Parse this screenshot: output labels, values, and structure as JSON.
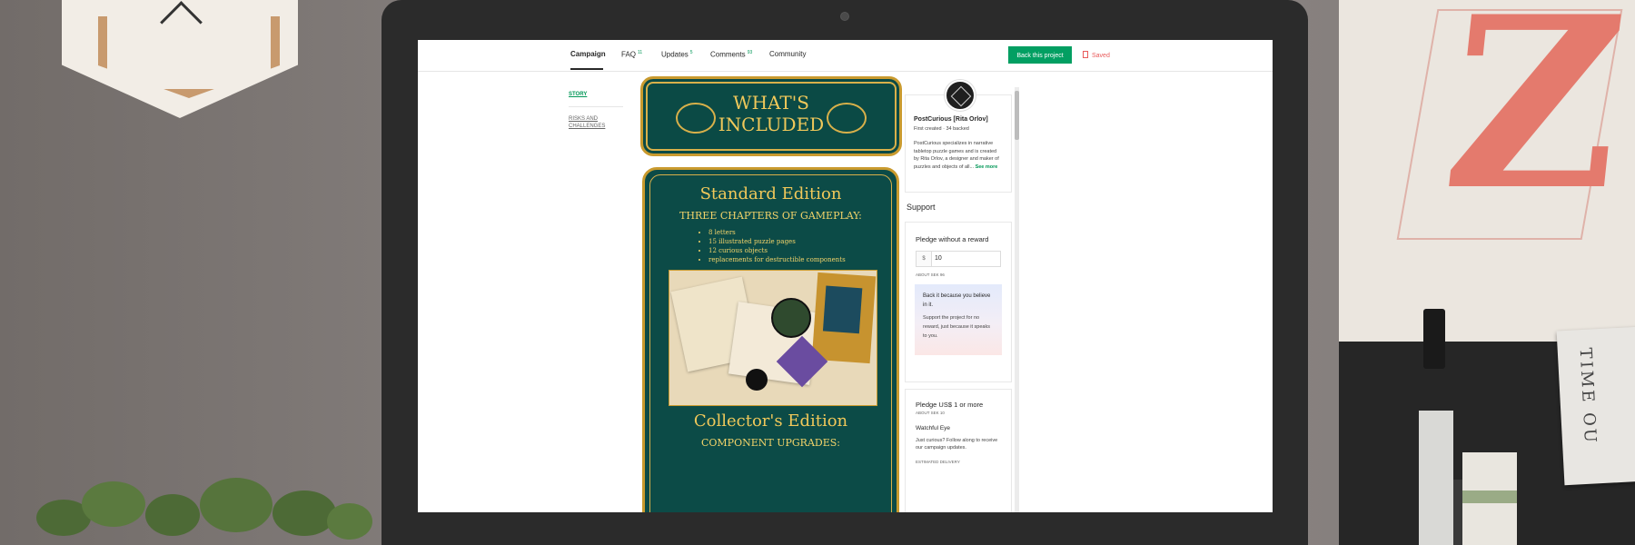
{
  "nav": {
    "tabs": [
      {
        "label": "Campaign",
        "count": ""
      },
      {
        "label": "FAQ",
        "count": "11"
      },
      {
        "label": "Updates",
        "count": "5"
      },
      {
        "label": "Comments",
        "count": "93"
      },
      {
        "label": "Community",
        "count": ""
      }
    ],
    "back_button": "Back this project",
    "saved": "Saved"
  },
  "sidebar_left": {
    "story": "STORY",
    "risks": "RISKS AND CHALLENGES"
  },
  "campaign": {
    "banner_line1": "WHAT'S",
    "banner_line2": "INCLUDED",
    "standard_title": "Standard Edition",
    "gameplay_heading": "THREE CHAPTERS OF GAMEPLAY:",
    "bullets": [
      "8 letters",
      "15 illustrated puzzle pages",
      "12 curious objects",
      "replacements for destructible components"
    ],
    "collectors_title": "Collector's Edition",
    "upgrades_heading": "COMPONENT UPGRADES:"
  },
  "creator": {
    "name": "PostCurious [Rita Orlov]",
    "stats": "First created · 34 backed",
    "bio": "PostCurious specializes in narrative tabletop puzzle games and is created by Rita Orlov, a designer and maker of puzzles and objects of all...",
    "see_more": "See more"
  },
  "support": {
    "heading": "Support",
    "no_reward": {
      "title": "Pledge without a reward",
      "currency": "$",
      "amount": "10",
      "about": "ABOUT SEK 96",
      "box_title": "Back it because you believe in it.",
      "box_text": "Support the project for no reward, just because it speaks to you."
    },
    "tier": {
      "title": "Pledge US$ 1 or more",
      "about": "ABOUT SEK 10",
      "name": "Watchful Eye",
      "desc": "Just curious? Follow along to receive our campaign updates.",
      "delivery": "ESTIMATED DELIVERY"
    }
  },
  "colors": {
    "accent_green": "#029757",
    "saved_red": "#e95a5a",
    "card_teal": "#0c4b47",
    "card_gold": "#c99a2e"
  }
}
